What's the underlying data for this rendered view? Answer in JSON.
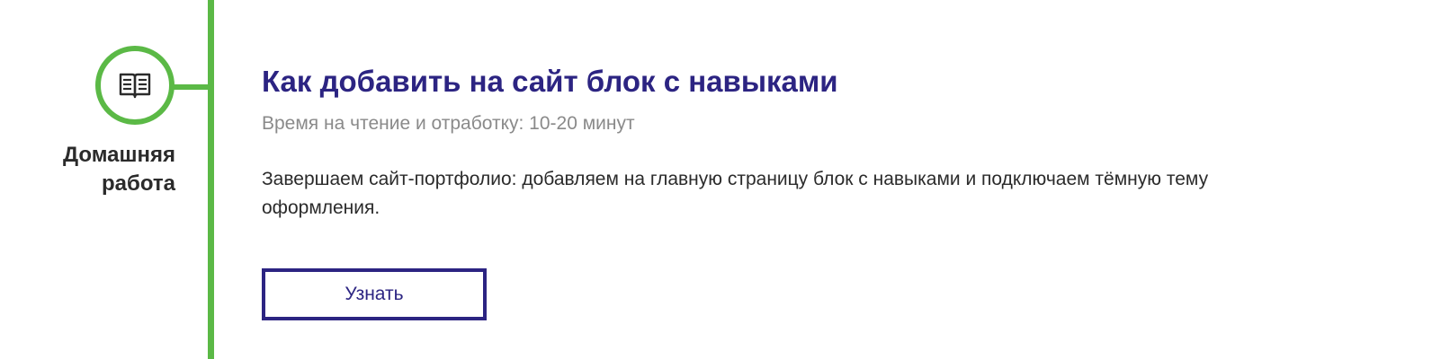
{
  "colors": {
    "timeline_green": "#5bb946",
    "title_purple": "#2c2482",
    "text_dark": "#2b2b2b",
    "text_muted": "#8a8a8a"
  },
  "step": {
    "icon": "open-book-icon",
    "label": "Домашняя работа"
  },
  "lesson": {
    "title": "Как добавить на сайт блок с навыками",
    "reading_time": "Время на чтение и отработку: 10-20 минут",
    "description": "Завершаем сайт-портфолио: добавляем на главную страницу блок с навыками и подключаем тёмную тему оформления.",
    "button_label": "Узнать"
  }
}
